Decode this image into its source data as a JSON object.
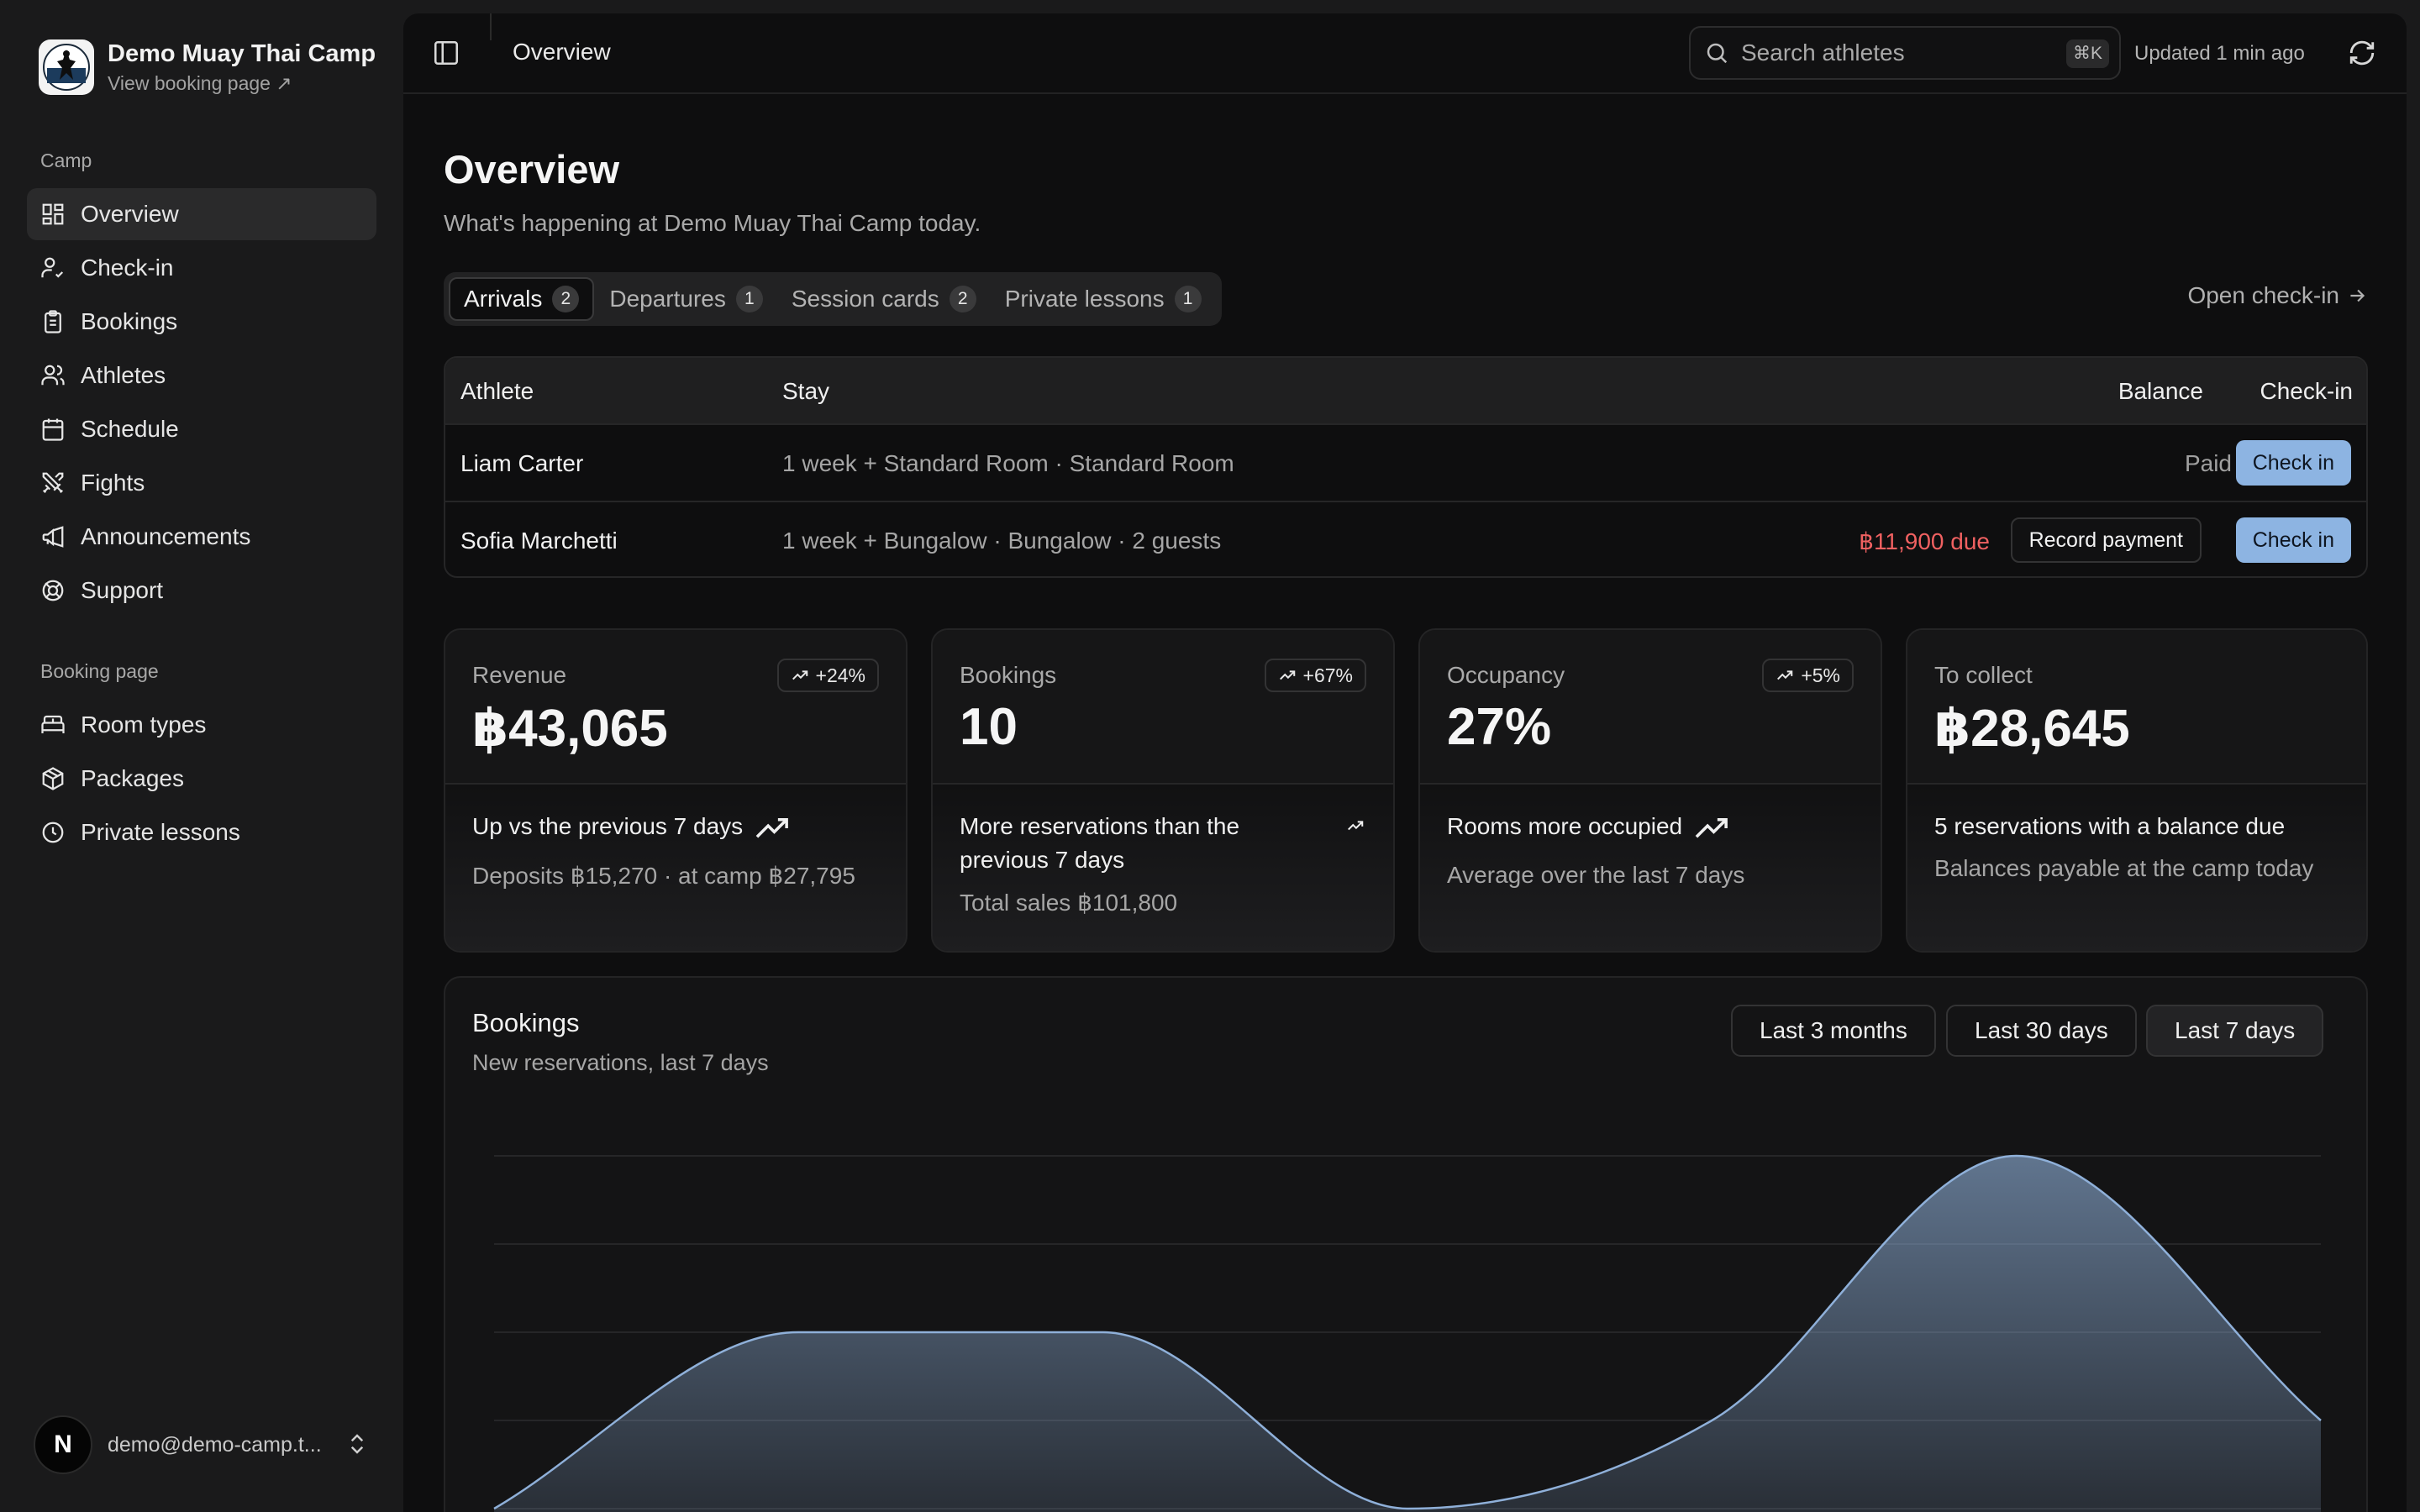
{
  "brand": {
    "title": "Demo Muay Thai Camp",
    "link": "View booking page ↗"
  },
  "sidebar": {
    "group_camp": "Camp",
    "camp_items": [
      {
        "label": "Overview",
        "icon": "grid-icon"
      },
      {
        "label": "Check-in",
        "icon": "user-check-icon"
      },
      {
        "label": "Bookings",
        "icon": "clipboard-icon"
      },
      {
        "label": "Athletes",
        "icon": "users-icon"
      },
      {
        "label": "Schedule",
        "icon": "calendar-icon"
      },
      {
        "label": "Fights",
        "icon": "swords-icon"
      },
      {
        "label": "Announcements",
        "icon": "megaphone-icon"
      },
      {
        "label": "Support",
        "icon": "lifebuoy-icon"
      }
    ],
    "group_booking": "Booking page",
    "booking_items": [
      {
        "label": "Room types",
        "icon": "bed-icon"
      },
      {
        "label": "Packages",
        "icon": "package-icon"
      },
      {
        "label": "Private lessons",
        "icon": "clock-icon"
      }
    ],
    "user": {
      "initial": "N",
      "email": "demo@demo-camp.t..."
    }
  },
  "topbar": {
    "crumb": "Overview",
    "search_placeholder": "Search athletes",
    "shortcut": "⌘K",
    "updated": "Updated 1 min ago"
  },
  "page": {
    "title": "Overview",
    "subtitle": "What's happening at Demo Muay Thai Camp today."
  },
  "tabs": [
    {
      "label": "Arrivals",
      "count": "2"
    },
    {
      "label": "Departures",
      "count": "1"
    },
    {
      "label": "Session cards",
      "count": "2"
    },
    {
      "label": "Private lessons",
      "count": "1"
    }
  ],
  "open_checkin": "Open check-in",
  "arrivals_table": {
    "headers": {
      "athlete": "Athlete",
      "stay": "Stay",
      "balance": "Balance",
      "checkin": "Check-in"
    },
    "rows": [
      {
        "athlete": "Liam Carter",
        "stay": "1 week + Standard Room · Standard Room",
        "balance": "Paid",
        "action": "Check in"
      },
      {
        "athlete": "Sofia Marchetti",
        "stay": "1 week + Bungalow · Bungalow · 2 guests",
        "balance": "฿11,900 due",
        "record": "Record payment",
        "action": "Check in"
      }
    ]
  },
  "cards": [
    {
      "label": "Revenue",
      "value": "฿43,065",
      "trend": "+24%",
      "headline": "Up vs the previous 7 days",
      "detail": "Deposits ฿15,270 · at camp ฿27,795"
    },
    {
      "label": "Bookings",
      "value": "10",
      "trend": "+67%",
      "headline": "More reservations than the previous 7 days",
      "detail": "Total sales ฿101,800"
    },
    {
      "label": "Occupancy",
      "value": "27%",
      "trend": "+5%",
      "headline": "Rooms more occupied",
      "detail": "Average over the last 7 days"
    },
    {
      "label": "To collect",
      "value": "฿28,645",
      "headline": "5 reservations with a balance due",
      "detail": "Balances payable at the camp today"
    }
  ],
  "bookings_chart": {
    "title": "Bookings",
    "subtitle": "New reservations, last 7 days",
    "ranges": [
      "Last 3 months",
      "Last 30 days",
      "Last 7 days"
    ],
    "active_range": "Last 7 days"
  },
  "chart_data": {
    "type": "area",
    "title": "Bookings",
    "subtitle": "New reservations, last 7 days",
    "x": [
      0,
      1,
      2,
      3,
      4,
      5,
      6
    ],
    "values": [
      0,
      2,
      2,
      0,
      1,
      4,
      1
    ],
    "ylim": [
      0,
      4
    ],
    "grid": true,
    "color": "#8fb0d9"
  },
  "colors": {
    "accent": "#8db4e2",
    "danger": "#f06161"
  }
}
